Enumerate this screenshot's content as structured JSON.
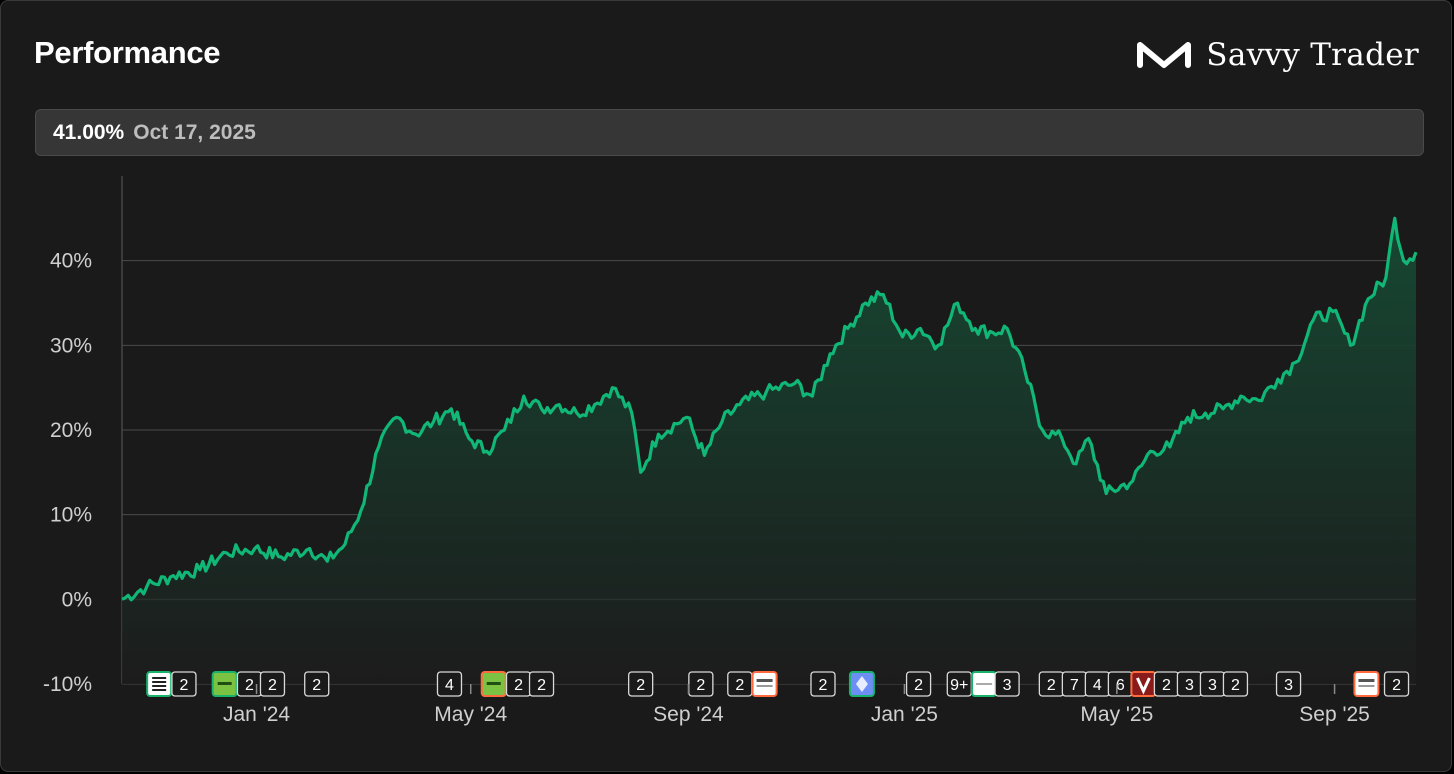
{
  "header": {
    "title": "Performance",
    "brand_name": "Savvy Trader"
  },
  "info": {
    "value": "41.00%",
    "date": "Oct 17, 2025"
  },
  "colors": {
    "line": "#10b777",
    "area_top": "#164a34",
    "area_bottom": "#1c1c1c",
    "grid": "#4a4a4a",
    "zero_line": "#bbbbbb",
    "badge_border": "#d9d9d9"
  },
  "chart_data": {
    "type": "area",
    "x_ticks": [
      "Jan '24",
      "May '24",
      "Sep '24",
      "Jan '25",
      "May '25",
      "Sep '25"
    ],
    "y_ticks": [
      "-10%",
      "0%",
      "10%",
      "20%",
      "30%",
      "40%"
    ],
    "ylim": [
      -10,
      50
    ],
    "y_unit": "%",
    "grid": true,
    "series": [
      {
        "x": [
          "2023-10-17",
          "2023-10-31",
          "2023-11-15",
          "2023-11-30",
          "2023-12-15",
          "2023-12-31",
          "2024-01-15",
          "2024-01-31",
          "2024-02-10",
          "2024-02-20",
          "2024-02-29",
          "2024-03-10",
          "2024-03-20",
          "2024-03-31",
          "2024-04-10",
          "2024-04-20",
          "2024-04-30",
          "2024-05-10",
          "2024-05-20",
          "2024-05-31",
          "2024-06-10",
          "2024-06-20",
          "2024-06-30",
          "2024-07-10",
          "2024-07-20",
          "2024-07-31",
          "2024-08-05",
          "2024-08-15",
          "2024-08-31",
          "2024-09-10",
          "2024-09-20",
          "2024-09-30",
          "2024-10-15",
          "2024-10-31",
          "2024-11-10",
          "2024-11-20",
          "2024-11-30",
          "2024-12-10",
          "2024-12-20",
          "2024-12-31",
          "2025-01-10",
          "2025-01-20",
          "2025-01-31",
          "2025-02-10",
          "2025-02-20",
          "2025-02-28",
          "2025-03-10",
          "2025-03-20",
          "2025-03-31",
          "2025-04-08",
          "2025-04-15",
          "2025-04-25",
          "2025-05-10",
          "2025-05-20",
          "2025-05-31",
          "2025-06-10",
          "2025-06-20",
          "2025-06-30",
          "2025-07-10",
          "2025-07-20",
          "2025-07-31",
          "2025-08-10",
          "2025-08-20",
          "2025-08-31",
          "2025-09-10",
          "2025-09-20",
          "2025-09-30",
          "2025-10-05",
          "2025-10-10",
          "2025-10-17"
        ],
        "values": [
          0,
          1.5,
          2.8,
          3.5,
          5.5,
          6.0,
          5.0,
          6.0,
          4.5,
          6.5,
          10.5,
          18.0,
          21.5,
          19.5,
          21.0,
          22.5,
          19.0,
          17.5,
          20.0,
          24.0,
          22.5,
          23.0,
          22.0,
          23.0,
          25.0,
          22.0,
          15.0,
          19.5,
          21.5,
          17.0,
          21.0,
          23.0,
          24.5,
          25.5,
          24.0,
          29.0,
          32.0,
          35.0,
          36.0,
          31.0,
          32.0,
          30.0,
          35.0,
          32.0,
          31.5,
          32.0,
          27.0,
          20.0,
          19.0,
          16.0,
          19.0,
          12.5,
          14.0,
          17.5,
          18.0,
          21.5,
          22.0,
          22.5,
          24.0,
          23.5,
          26.0,
          28.0,
          33.0,
          34.0,
          30.0,
          35.5,
          38.0,
          45.0,
          40.0,
          41.0
        ]
      }
    ],
    "event_badges": [
      {
        "x": "2023-11-07",
        "kind": "logo",
        "icon": "state-street-logo-icon",
        "accent": "#19b26b"
      },
      {
        "x": "2023-11-21",
        "kind": "count",
        "label": "2"
      },
      {
        "x": "2023-12-14",
        "kind": "logo",
        "icon": "ishares-logo-icon",
        "accent": "#19b26b"
      },
      {
        "x": "2023-12-28",
        "kind": "count",
        "label": "2"
      },
      {
        "x": "2024-01-10",
        "kind": "count",
        "label": "2"
      },
      {
        "x": "2024-02-04",
        "kind": "count",
        "label": "2"
      },
      {
        "x": "2024-04-19",
        "kind": "count",
        "label": "4"
      },
      {
        "x": "2024-05-14",
        "kind": "logo",
        "icon": "ishares-logo-icon",
        "accent": "#ff6b3d"
      },
      {
        "x": "2024-05-28",
        "kind": "count",
        "label": "2"
      },
      {
        "x": "2024-06-10",
        "kind": "count",
        "label": "2"
      },
      {
        "x": "2024-08-05",
        "kind": "count",
        "label": "2"
      },
      {
        "x": "2024-09-08",
        "kind": "count",
        "label": "2"
      },
      {
        "x": "2024-09-30",
        "kind": "count",
        "label": "2"
      },
      {
        "x": "2024-10-14",
        "kind": "logo",
        "icon": "uscf-logo-icon",
        "accent": "#ff6b3d"
      },
      {
        "x": "2024-11-16",
        "kind": "count",
        "label": "2"
      },
      {
        "x": "2024-12-08",
        "kind": "logo",
        "icon": "ethereum-icon",
        "accent": "#19b26b"
      },
      {
        "x": "2025-01-09",
        "kind": "count",
        "label": "2"
      },
      {
        "x": "2025-02-01",
        "kind": "count",
        "label": "9+"
      },
      {
        "x": "2025-02-15",
        "kind": "logo",
        "icon": "fund-logo-icon",
        "accent": "#19b26b"
      },
      {
        "x": "2025-02-28",
        "kind": "count",
        "label": "3"
      },
      {
        "x": "2025-03-25",
        "kind": "count",
        "label": "2"
      },
      {
        "x": "2025-04-07",
        "kind": "count",
        "label": "7"
      },
      {
        "x": "2025-04-20",
        "kind": "count",
        "label": "4"
      },
      {
        "x": "2025-05-03",
        "kind": "count",
        "label": "6"
      },
      {
        "x": "2025-05-16",
        "kind": "logo",
        "icon": "visa-logo-icon",
        "accent": "#ff6b3d"
      },
      {
        "x": "2025-05-29",
        "kind": "count",
        "label": "2"
      },
      {
        "x": "2025-06-11",
        "kind": "count",
        "label": "3"
      },
      {
        "x": "2025-06-24",
        "kind": "count",
        "label": "3"
      },
      {
        "x": "2025-07-07",
        "kind": "count",
        "label": "2"
      },
      {
        "x": "2025-08-06",
        "kind": "count",
        "label": "3"
      },
      {
        "x": "2025-09-19",
        "kind": "logo",
        "icon": "uscf-logo-icon",
        "accent": "#ff6b3d"
      },
      {
        "x": "2025-10-06",
        "kind": "count",
        "label": "2"
      }
    ]
  }
}
